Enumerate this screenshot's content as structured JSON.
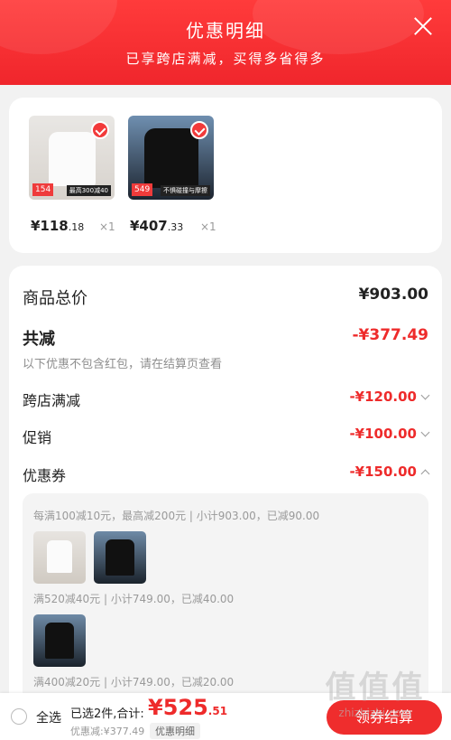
{
  "header": {
    "title": "优惠明细",
    "subtitle": "已享跨店满减，买得多省得多"
  },
  "products": [
    {
      "price_int": "¥118",
      "price_dec": ".18",
      "qty": "×1",
      "badge": "154",
      "banner": "最高300减40"
    },
    {
      "price_int": "¥407",
      "price_dec": ".33",
      "qty": "×1",
      "badge": "549",
      "banner": "不惧碰撞与摩擦"
    }
  ],
  "summary": {
    "total_label": "商品总价",
    "total_value": "¥903.00",
    "reduce_label": "共减",
    "reduce_value": "-¥377.49",
    "note": "以下优惠不包含红包，请在结算页查看"
  },
  "discounts": [
    {
      "label": "跨店满减",
      "value": "-¥120.00"
    },
    {
      "label": "促销",
      "value": "-¥100.00"
    },
    {
      "label": "优惠券",
      "value": "-¥150.00"
    }
  ],
  "coupon_rules": [
    "每满100减10元，最高减200元 | 小计903.00，已减90.00",
    "满520减40元 | 小计749.00，已减40.00",
    "满400减20元 | 小计749.00，已减20.00"
  ],
  "bottom": {
    "select_all": "全选",
    "selected": "已选2件,合计:",
    "total_int": "¥525",
    "total_dec": ".51",
    "discount": "优惠减:¥377.49",
    "detail_btn": "优惠明细",
    "checkout": "领券结算"
  },
  "watermark": {
    "logo": "值值值",
    "site": "zhizhizhi.com"
  }
}
